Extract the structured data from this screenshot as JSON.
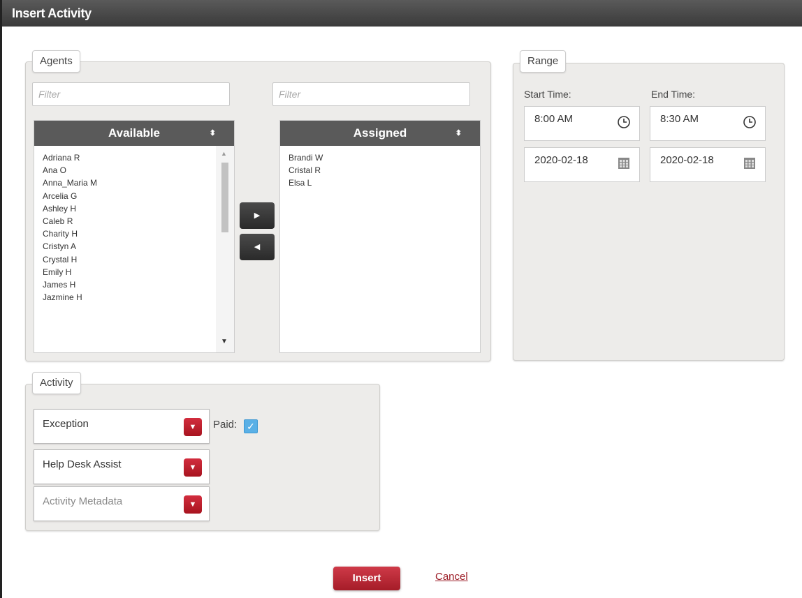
{
  "dialog": {
    "title": "Insert Activity"
  },
  "agents": {
    "legend": "Agents",
    "available_filter_placeholder": "Filter",
    "assigned_filter_placeholder": "Filter",
    "available_header": "Available",
    "assigned_header": "Assigned",
    "available": [
      "Adriana R",
      "Ana O",
      "Anna_Maria M",
      "Arcelia G",
      "Ashley H",
      "Caleb R",
      "Charity H",
      "Cristyn A",
      "Crystal H",
      "Emily H",
      "James H",
      "Jazmine H"
    ],
    "assigned": [
      "Brandi W",
      "Cristal R",
      "Elsa L"
    ],
    "move_right_glyph": "▶",
    "move_left_glyph": "◀",
    "sort_glyph": "⬍"
  },
  "range": {
    "legend": "Range",
    "start_label": "Start Time:",
    "end_label": "End Time:",
    "start_time": "8:00 AM",
    "end_time": "8:30 AM",
    "start_date": "2020-02-18",
    "end_date": "2020-02-18"
  },
  "activity": {
    "legend": "Activity",
    "type": "Exception",
    "name": "Help Desk Assist",
    "metadata_placeholder": "Activity Metadata",
    "paid_label": "Paid:",
    "paid_checked": true
  },
  "actions": {
    "insert_label": "Insert",
    "cancel_label": "Cancel"
  },
  "colors": {
    "accent_red": "#b51f2c",
    "header_dark": "#5a5a5a",
    "checkbox_blue": "#5ab0e6"
  }
}
